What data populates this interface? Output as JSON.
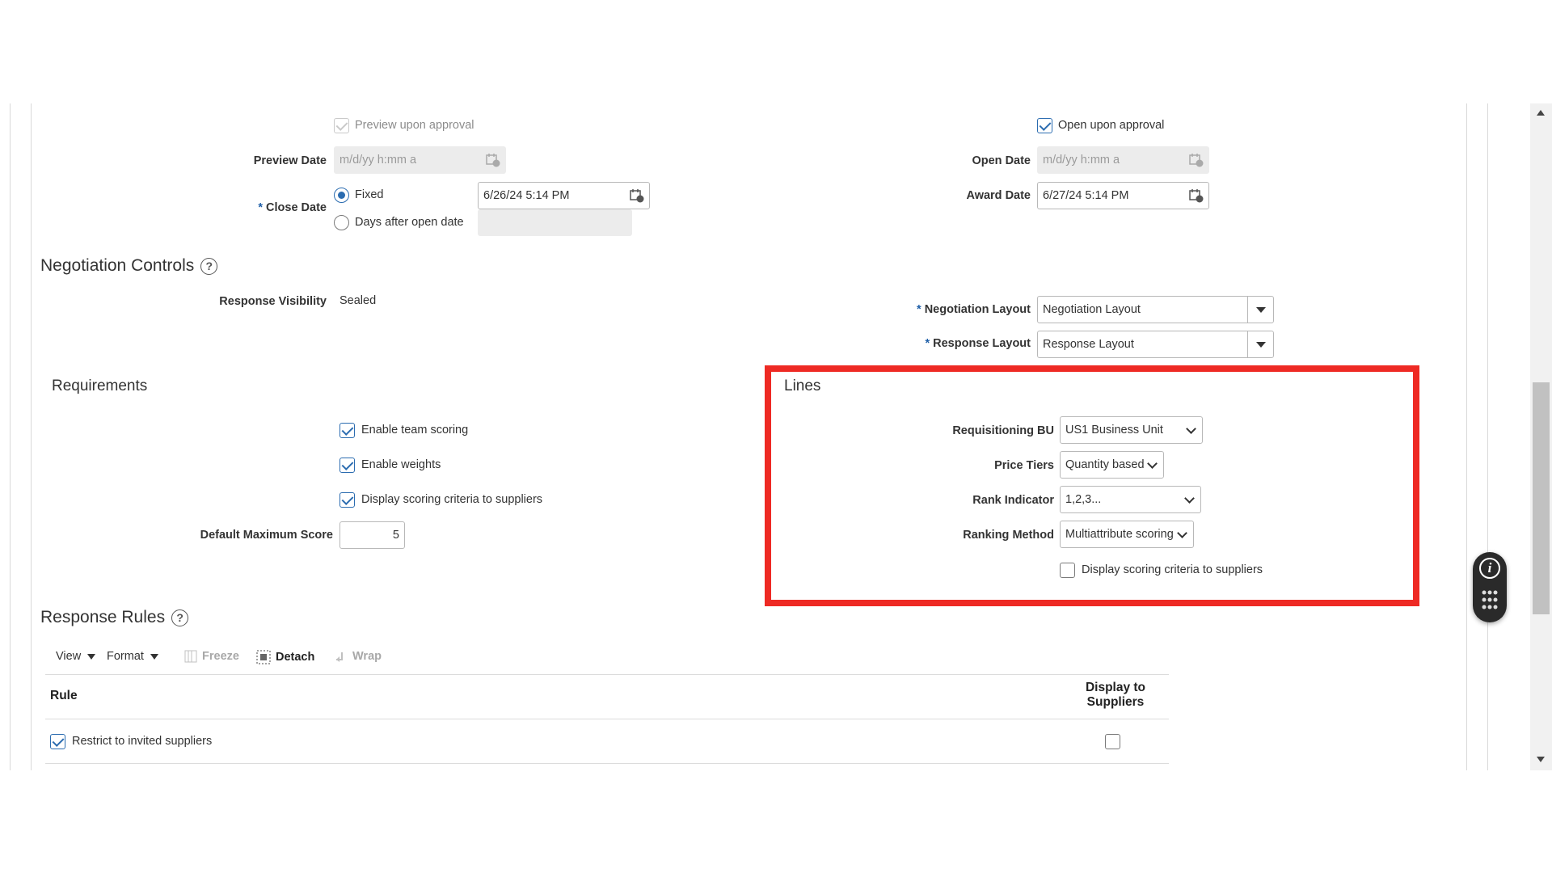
{
  "schedule": {
    "preview_upon_approval": "Preview upon approval",
    "open_upon_approval": "Open upon approval",
    "preview_date_label": "Preview Date",
    "preview_date_placeholder": "m/d/yy h:mm a",
    "open_date_label": "Open Date",
    "open_date_placeholder": "m/d/yy h:mm a",
    "close_date_label": "Close Date",
    "close_fixed": "Fixed",
    "close_days_after": "Days after open date",
    "close_date_value": "6/26/24 5:14 PM",
    "award_date_label": "Award Date",
    "award_date_value": "6/27/24 5:14 PM"
  },
  "negotiation_controls": {
    "title": "Negotiation Controls",
    "response_visibility_label": "Response Visibility",
    "response_visibility_value": "Sealed",
    "negotiation_layout_label": "Negotiation Layout",
    "negotiation_layout_value": "Negotiation Layout",
    "response_layout_label": "Response Layout",
    "response_layout_value": "Response Layout"
  },
  "requirements": {
    "title": "Requirements",
    "enable_team_scoring": "Enable team scoring",
    "enable_weights": "Enable weights",
    "display_scoring_criteria": "Display scoring criteria to suppliers",
    "default_max_score_label": "Default Maximum Score",
    "default_max_score_value": "5"
  },
  "lines": {
    "title": "Lines",
    "requisitioning_bu_label": "Requisitioning BU",
    "requisitioning_bu_value": "US1 Business Unit",
    "price_tiers_label": "Price Tiers",
    "price_tiers_value": "Quantity based",
    "rank_indicator_label": "Rank Indicator",
    "rank_indicator_value": "1,2,3...",
    "ranking_method_label": "Ranking Method",
    "ranking_method_value": "Multiattribute scoring",
    "display_scoring_criteria": "Display scoring criteria to suppliers",
    "highlight_color": "#ee2a24"
  },
  "response_rules": {
    "title": "Response Rules",
    "toolbar": {
      "view": "View",
      "format": "Format",
      "freeze": "Freeze",
      "detach": "Detach",
      "wrap": "Wrap"
    },
    "columns": [
      "Rule",
      "Display to Suppliers"
    ],
    "rows": [
      {
        "rule": "Restrict to invited suppliers"
      }
    ]
  },
  "help_icon_glyph": "?",
  "info_icon_glyph": "i",
  "accent_color": "#2b6cb0"
}
